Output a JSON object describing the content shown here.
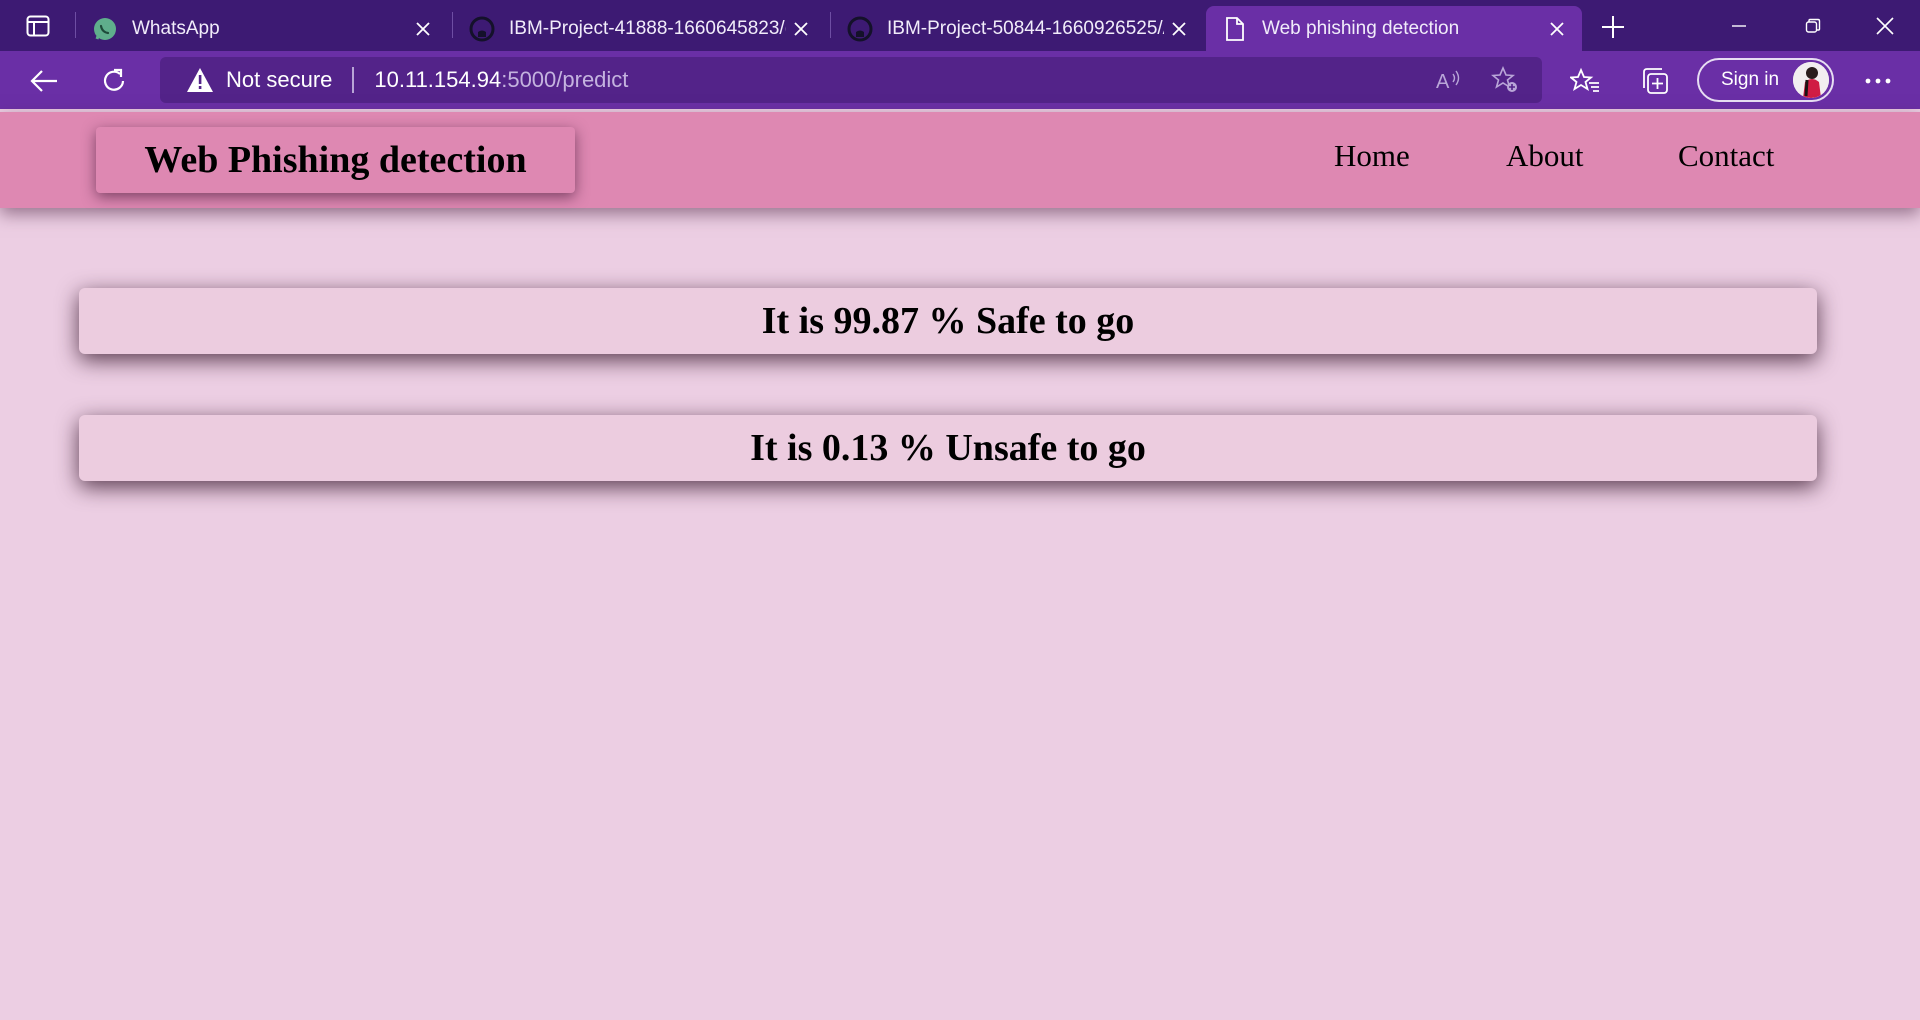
{
  "browser": {
    "tabs": [
      {
        "title": "WhatsApp",
        "icon": "whatsapp-icon"
      },
      {
        "title": "IBM-Project-41888-1660645823/(",
        "icon": "github-icon"
      },
      {
        "title": "IBM-Project-50844-1660926525/A",
        "icon": "github-icon"
      },
      {
        "title": "Web phishing detection",
        "icon": "page-icon",
        "active": true
      }
    ],
    "address": {
      "security_label": "Not secure",
      "url_host": "10.11.154.94",
      "url_rest": ":5000/predict"
    },
    "signin_label": "Sign in",
    "colors": {
      "tabbar": "#3d1a73",
      "toolbar": "#6a2fa6",
      "address": "#532389"
    }
  },
  "site": {
    "brand": "Web Phishing detection",
    "nav": [
      "Home",
      "About",
      "Contact"
    ],
    "colors": {
      "header": "#de88b2",
      "background": "#eccee3",
      "result_box": "#ecccdf"
    }
  },
  "results": {
    "safe_text": "It is 99.87 % Safe to go",
    "unsafe_text": "It is 0.13 % Unsafe to go"
  }
}
